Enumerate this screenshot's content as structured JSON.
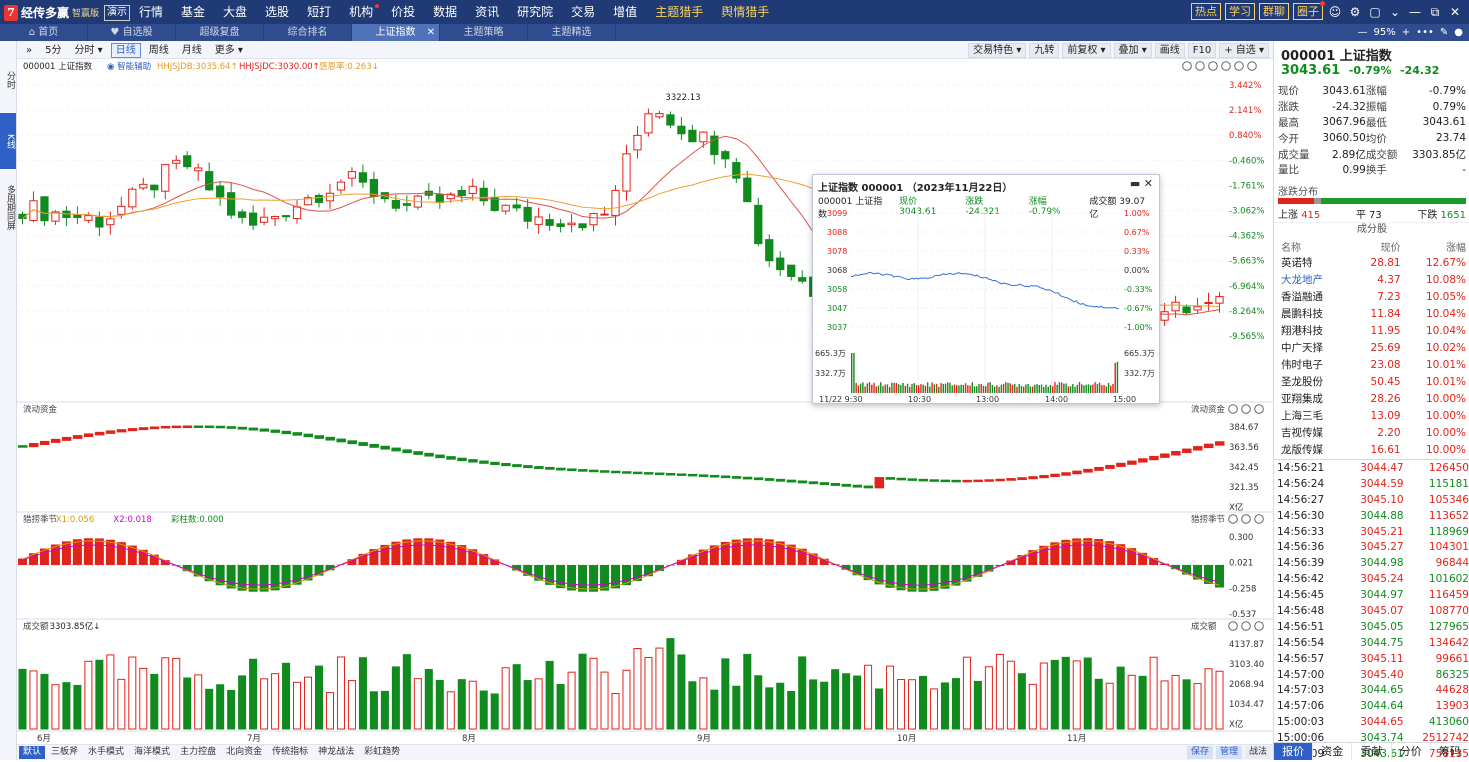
{
  "app": {
    "logo_mark": "7",
    "name": "经传多赢",
    "edition": "智赢版",
    "demo_badge": "演示"
  },
  "menu": [
    "行情",
    "基金",
    "大盘",
    "选股",
    "短打",
    "机构",
    "价投",
    "数据",
    "资讯",
    "研究院",
    "交易",
    "增值",
    "主题猎手",
    "舆情猎手"
  ],
  "top_buttons": [
    "热点",
    "学习",
    "群聊",
    "圈子"
  ],
  "tabs": [
    {
      "label": "首页",
      "icon": "home-icon"
    },
    {
      "label": "自选股",
      "icon": "heart-icon"
    },
    {
      "label": "超级复盘"
    },
    {
      "label": "综合排名"
    },
    {
      "label": "上证指数",
      "active": true
    },
    {
      "label": "主题策略"
    },
    {
      "label": "主题精选"
    }
  ],
  "zoom": "95%",
  "left_strip": [
    "分时",
    "K线",
    "多周期同屏"
  ],
  "periods": {
    "toggle": "»",
    "items": [
      "5分",
      "分时 ▾",
      "日线",
      "周线",
      "月线",
      "更多 ▾"
    ],
    "active": "日线"
  },
  "tool_right": [
    "交易特色 ▾",
    "九转",
    "前复权 ▾",
    "叠加 ▾",
    "画线",
    "F10",
    "+ 自选 ▾"
  ],
  "kline_header": {
    "name": "000001 上证指数",
    "assist": "智能辅助",
    "db": "HHJSJDB:3035.64",
    "dc": "HHJSJDC:3030.00",
    "fear": "感恩率:0.263"
  },
  "kline_high_label": "3322.13",
  "kline_axis": [
    "3.442%",
    "2.141%",
    "0.840%",
    "-0.460%",
    "-1.761%",
    "-3.062%",
    "-4.362%",
    "-5.663%",
    "-6.964%",
    "-8.264%",
    "-9.565%"
  ],
  "fund_panel": {
    "title": "流动资金",
    "axis": [
      "384.67",
      "363.56",
      "342.45",
      "321.35",
      "X亿"
    ]
  },
  "bull_panel": {
    "title": "猎捞季节",
    "x1": "X1:0.056",
    "x2": "X2:0.018",
    "bars": "彩柱数:0.000",
    "axis": [
      "0.300",
      "0.021",
      "-0.258",
      "-0.537"
    ]
  },
  "vol_panel": {
    "title": "成交额",
    "value": "3303.85亿",
    "axis": [
      "4137.87",
      "3103.40",
      "2068.94",
      "1034.47",
      "X亿"
    ]
  },
  "months": [
    "6月",
    "7月",
    "8月",
    "9月",
    "10月",
    "11月"
  ],
  "bottom_tabs": [
    "默认",
    "三板斧",
    "水手模式",
    "海洋模式",
    "主力控盘",
    "北向资金",
    "传统指标",
    "神龙战法",
    "彩虹趋势"
  ],
  "bottom_right": [
    "保存",
    "管理",
    "战法"
  ],
  "quote": {
    "code_name": "000001 上证指数",
    "price": "3043.61",
    "pct": "-0.79%",
    "chg": "-24.32",
    "rows": [
      [
        "现价",
        "3043.61",
        "涨幅",
        "-0.79%"
      ],
      [
        "涨跌",
        "-24.32",
        "振幅",
        "0.79%"
      ],
      [
        "最高",
        "3067.96",
        "最低",
        "3043.61"
      ],
      [
        "今开",
        "3060.50",
        "均价",
        "23.74"
      ],
      [
        "成交量",
        "2.89亿",
        "成交额",
        "3303.85亿"
      ],
      [
        "量比",
        "0.99",
        "换手",
        "-"
      ]
    ]
  },
  "distribution": {
    "title": "涨跌分布",
    "up_label": "上涨",
    "up": 415,
    "flat_label": "平",
    "flat": 73,
    "down_label": "下跌",
    "down": 1651
  },
  "components": {
    "title": "成分股",
    "headers": [
      "名称",
      "现价",
      "涨幅"
    ],
    "rows": [
      [
        "英诺特",
        "28.81",
        "12.67%"
      ],
      [
        "大龙地产",
        "4.37",
        "10.08%"
      ],
      [
        "香溢融通",
        "7.23",
        "10.05%"
      ],
      [
        "晨鹏科技",
        "11.84",
        "10.04%"
      ],
      [
        "翔港科技",
        "11.95",
        "10.04%"
      ],
      [
        "中广天择",
        "25.69",
        "10.02%"
      ],
      [
        "伟时电子",
        "23.08",
        "10.01%"
      ],
      [
        "圣龙股份",
        "50.45",
        "10.01%"
      ],
      [
        "亚翔集成",
        "28.26",
        "10.00%"
      ],
      [
        "上海三毛",
        "13.09",
        "10.00%"
      ],
      [
        "吉视传媒",
        "2.20",
        "10.00%"
      ],
      [
        "龙版传媒",
        "16.61",
        "10.00%"
      ]
    ]
  },
  "ticks": [
    [
      "14:56:21",
      "3044.47",
      "126450"
    ],
    [
      "14:56:24",
      "3044.59",
      "115181"
    ],
    [
      "14:56:27",
      "3045.10",
      "105346"
    ],
    [
      "14:56:30",
      "3044.88",
      "113652"
    ],
    [
      "14:56:33",
      "3045.21",
      "118969"
    ],
    [
      "14:56:36",
      "3045.27",
      "104301"
    ],
    [
      "14:56:39",
      "3044.98",
      "96844"
    ],
    [
      "14:56:42",
      "3045.24",
      "101602"
    ],
    [
      "14:56:45",
      "3044.97",
      "116459"
    ],
    [
      "14:56:48",
      "3045.07",
      "108770"
    ],
    [
      "14:56:51",
      "3045.05",
      "127965"
    ],
    [
      "14:56:54",
      "3044.75",
      "134642"
    ],
    [
      "14:56:57",
      "3045.11",
      "99661"
    ],
    [
      "14:57:00",
      "3045.40",
      "86325"
    ],
    [
      "14:57:03",
      "3044.65",
      "44628"
    ],
    [
      "14:57:06",
      "3044.64",
      "13903"
    ],
    [
      "15:00:03",
      "3044.65",
      "413060"
    ],
    [
      "15:00:06",
      "3043.74",
      "2512742"
    ],
    [
      "15:00:09",
      "3043.61",
      "758135"
    ]
  ],
  "panel_tabs": [
    "报价",
    "资金",
    "贡献",
    "分价",
    "筹码"
  ],
  "popup": {
    "title": "上证指数 000001 （2023年11月22日）",
    "name": "000001 上证指数",
    "price": "现价 3043.61",
    "chg": "涨跌 -24.321",
    "pct": "涨幅 -0.79%",
    "amount": "成交额 39.07亿",
    "left_axis": [
      "3099",
      "3088",
      "3078",
      "3068",
      "3058",
      "3047",
      "3037"
    ],
    "right_axis": [
      "1.00%",
      "0.67%",
      "0.33%",
      "0.00%",
      "-0.33%",
      "-0.67%",
      "-1.00%"
    ],
    "vol_axis": [
      "665.3万",
      "332.7万"
    ],
    "time_axis": [
      "11/22 9:30",
      "10:30",
      "13:00",
      "14:00",
      "15:00"
    ]
  },
  "colors": {
    "up": "#e2231a",
    "down": "#118a1e",
    "ma1": "#e0524a",
    "ma2": "#f0a030",
    "line": "#3a6fd8",
    "accent": "#2f60c5"
  }
}
